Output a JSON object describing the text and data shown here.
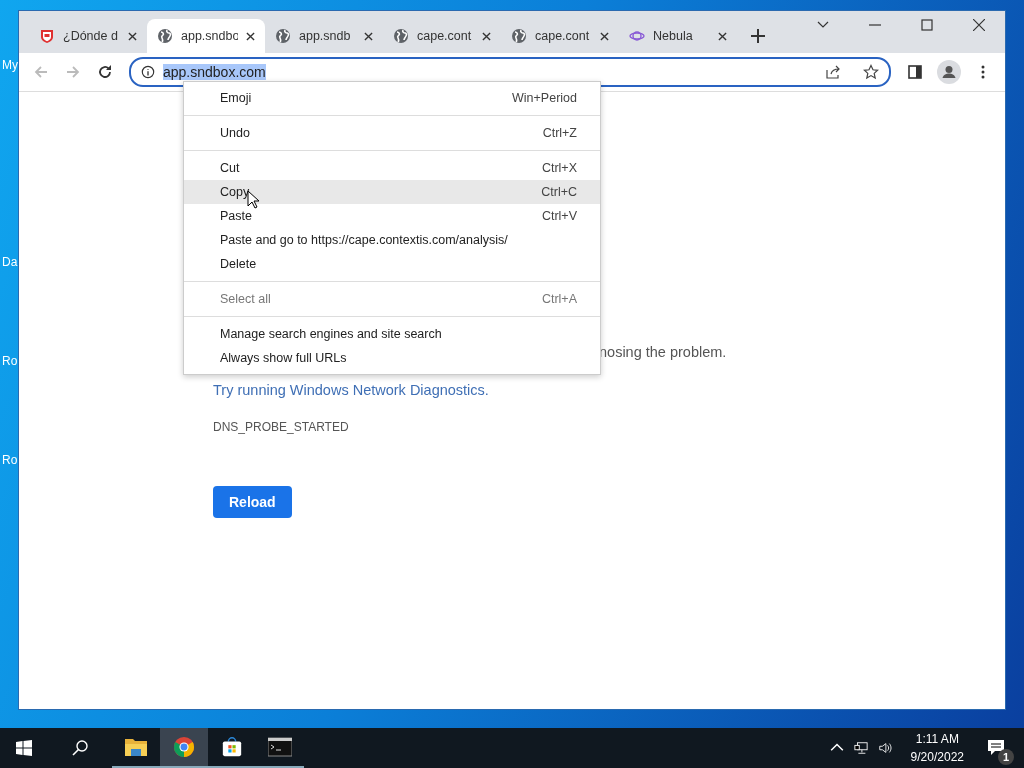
{
  "desktop": {
    "icon_labels": [
      "My",
      "Da",
      "Ro",
      "Ro"
    ]
  },
  "browser": {
    "tabs": [
      {
        "title": "¿Dónde d",
        "kind": "shield",
        "selected": false
      },
      {
        "title": "app.sndbo",
        "kind": "globe",
        "selected": true
      },
      {
        "title": "app.sndb",
        "kind": "globe",
        "selected": false
      },
      {
        "title": "cape.cont",
        "kind": "globe",
        "selected": false
      },
      {
        "title": "cape.cont",
        "kind": "globe",
        "selected": false
      },
      {
        "title": "Nebula",
        "kind": "planet",
        "selected": false
      }
    ],
    "address_bar": {
      "value": "app.sndbox.com",
      "text_selected": true,
      "focused": true
    }
  },
  "page": {
    "partial_text": "nosing the problem.",
    "link": "Try running Windows Network Diagnostics.",
    "error_code": "DNS_PROBE_STARTED",
    "button": "Reload"
  },
  "context_menu": {
    "items": [
      {
        "kind": "item",
        "label": "Emoji",
        "shortcut": "Win+Period",
        "disabled": false,
        "selected": false
      },
      {
        "kind": "separator"
      },
      {
        "kind": "item",
        "label": "Undo",
        "shortcut": "Ctrl+Z",
        "disabled": false,
        "selected": false
      },
      {
        "kind": "separator"
      },
      {
        "kind": "item",
        "label": "Cut",
        "shortcut": "Ctrl+X",
        "disabled": false,
        "selected": false
      },
      {
        "kind": "item",
        "label": "Copy",
        "shortcut": "Ctrl+C",
        "disabled": false,
        "selected": true
      },
      {
        "kind": "item",
        "label": "Paste",
        "shortcut": "Ctrl+V",
        "disabled": false,
        "selected": false
      },
      {
        "kind": "item",
        "label": "Paste and go to https://cape.contextis.com/analysis/",
        "disabled": false,
        "selected": false
      },
      {
        "kind": "item",
        "label": "Delete",
        "disabled": false,
        "selected": false
      },
      {
        "kind": "separator"
      },
      {
        "kind": "item",
        "label": "Select all",
        "shortcut": "Ctrl+A",
        "disabled": true,
        "selected": false
      },
      {
        "kind": "separator"
      },
      {
        "kind": "item",
        "label": "Manage search engines and site search",
        "disabled": false,
        "selected": false
      },
      {
        "kind": "item",
        "label": "Always show full URLs",
        "disabled": false,
        "selected": false
      }
    ]
  },
  "taskbar": {
    "apps": [
      {
        "active": false
      },
      {
        "active": true
      },
      {
        "active": false
      },
      {
        "active": false
      }
    ],
    "clock": {
      "time": "1:11 AM",
      "date": "9/20/2022"
    },
    "notification_count": "1"
  }
}
